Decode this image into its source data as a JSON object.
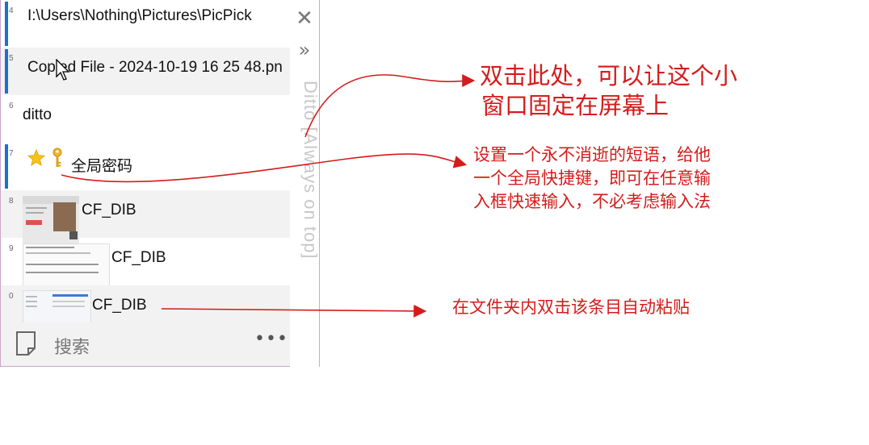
{
  "window": {
    "title_vertical": "Ditto [Always on top]",
    "close_glyph": "✕",
    "collapse_glyph": "»"
  },
  "clips": [
    {
      "index": "4",
      "text": "I:\\Users\\Nothing\\Pictures\\PicPick"
    },
    {
      "index": "5",
      "text": "Copied File - 2024-10-19 16 25 48.pn"
    },
    {
      "index": "6",
      "text": "ditto"
    },
    {
      "index": "7",
      "text": "全局密码",
      "icons": [
        "star-icon",
        "key-icon"
      ]
    },
    {
      "index": "8",
      "text": "CF_DIB"
    },
    {
      "index": "9",
      "text": "CF_DIB"
    },
    {
      "index": "0",
      "text": "CF_DIB"
    }
  ],
  "footer": {
    "search_label": "搜索",
    "more_glyph": "•••"
  },
  "annotations": {
    "note1": [
      "双击此处，可以让这个小",
      "窗口固定在屏幕上"
    ],
    "note2": [
      "设置一个永不消逝的短语，给他",
      "一个全局快捷键，即可在任意输",
      "入框快速输入，不必考虑输入法"
    ],
    "note3": [
      "在文件夹内双击该条目自动粘贴"
    ]
  },
  "colors": {
    "accent_bar": "#1e6fcf",
    "annotation": "#d41c1c",
    "row_shade": "#f2f2f2",
    "window_border": "#c9a6c9"
  }
}
